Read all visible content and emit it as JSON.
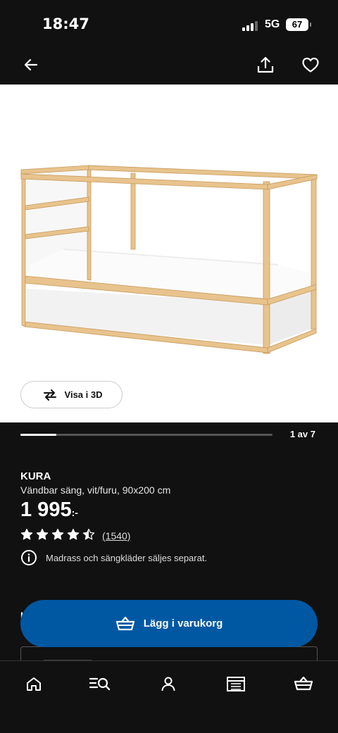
{
  "status": {
    "time": "18:47",
    "network": "5G",
    "battery": "67"
  },
  "product": {
    "brand": "KURA",
    "description": "Vändbar säng, vit/furu, 90x200 cm",
    "price": "1 995",
    "price_suffix": ":-",
    "rating_value": 4.5,
    "rating_max": 5,
    "review_count": "(1540)",
    "notice": "Madrass och sängkläder säljes separat."
  },
  "gallery": {
    "view3d_label": "Visa i 3D",
    "page_indicator": "1 av 7",
    "current": 1,
    "total": 7
  },
  "cta": {
    "label": "Lägg i varukorg"
  },
  "partial_letter": "L",
  "colors": {
    "background": "#111111",
    "accent": "#0058a3",
    "star": "#ffffff"
  },
  "icons": {
    "nav": [
      "back-arrow-icon",
      "share-icon",
      "heart-icon"
    ],
    "tabs": [
      "home-icon",
      "search-list-icon",
      "profile-icon",
      "store-icon",
      "basket-icon"
    ]
  }
}
